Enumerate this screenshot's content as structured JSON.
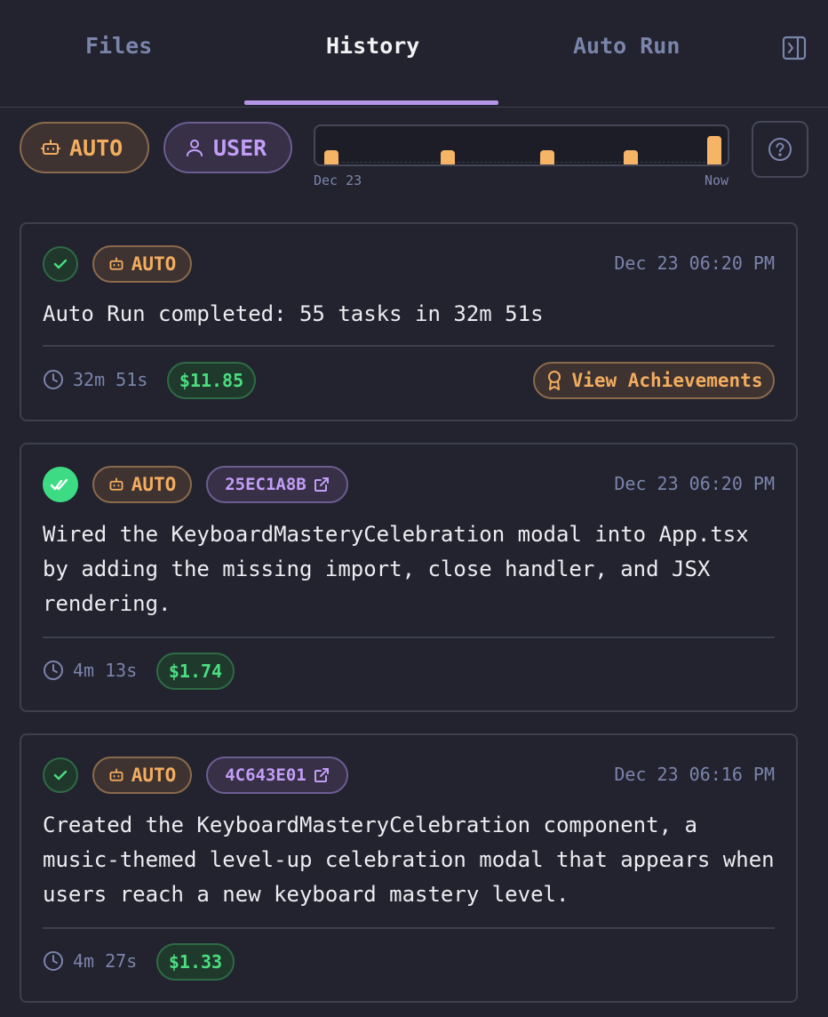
{
  "tabs": [
    {
      "label": "Files"
    },
    {
      "label": "History"
    },
    {
      "label": "Auto Run"
    }
  ],
  "active_tab": "History",
  "filters": {
    "auto_label": "AUTO",
    "user_label": "USER"
  },
  "timeline": {
    "start_label": "Dec 23",
    "end_label": "Now",
    "bar_levels": [
      0.4,
      0.4,
      0.4,
      0.4,
      0.8
    ]
  },
  "colors": {
    "background": "#22232e",
    "accent_auto": "#f3ad5f",
    "accent_user": "#c29ef7",
    "success": "#4ade80",
    "tab_active_underline": "#b595e8"
  },
  "entries": [
    {
      "status": "success",
      "type_label": "AUTO",
      "timestamp": "Dec 23 06:20 PM",
      "summary": "Auto Run completed: 55 tasks in 32m 51s",
      "duration": "32m 51s",
      "cost": "$11.85",
      "action_label": "View Achievements"
    },
    {
      "status": "success-verified",
      "type_label": "AUTO",
      "session_id": "25EC1A8B",
      "timestamp": "Dec 23 06:20 PM",
      "summary": "Wired the KeyboardMasteryCelebration modal into App.tsx\nby adding the missing import, close handler, and JSX\nrendering.",
      "duration": "4m 13s",
      "cost": "$1.74"
    },
    {
      "status": "success",
      "type_label": "AUTO",
      "session_id": "4C643E01",
      "timestamp": "Dec 23 06:16 PM",
      "summary": "Created the KeyboardMasteryCelebration component, a\nmusic-themed level-up celebration modal that appears when\nusers reach a new keyboard mastery level.",
      "duration": "4m 27s",
      "cost": "$1.33"
    }
  ]
}
